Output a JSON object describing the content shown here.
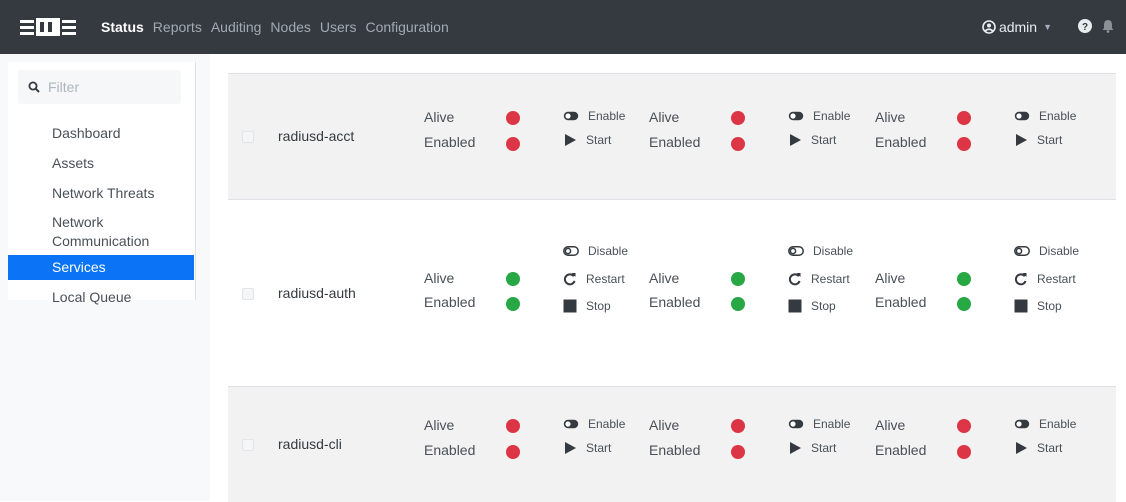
{
  "nav": {
    "items": [
      "Status",
      "Reports",
      "Auditing",
      "Nodes",
      "Users",
      "Configuration"
    ],
    "user": "admin"
  },
  "sidebar": {
    "filter_placeholder": "Filter",
    "items": [
      "Dashboard",
      "Assets",
      "Network Threats",
      "Network",
      "Communication",
      "Services",
      "Local Queue"
    ]
  },
  "labels": {
    "alive": "Alive",
    "enabled": "Enabled",
    "enable": "Enable",
    "disable": "Disable",
    "start": "Start",
    "restart": "Restart",
    "stop": "Stop"
  },
  "services": [
    {
      "name": "radiusd-acct",
      "status": [
        "red",
        "red",
        "red"
      ]
    },
    {
      "name": "radiusd-auth",
      "status": [
        "green",
        "green",
        "green"
      ]
    },
    {
      "name": "radiusd-cli",
      "status": [
        "red",
        "red",
        "red"
      ]
    }
  ],
  "colors": {
    "alive_on": "#28a745",
    "alive_off": "#dc3545",
    "active_nav": "#0b74f6",
    "topbar": "#343a40"
  }
}
